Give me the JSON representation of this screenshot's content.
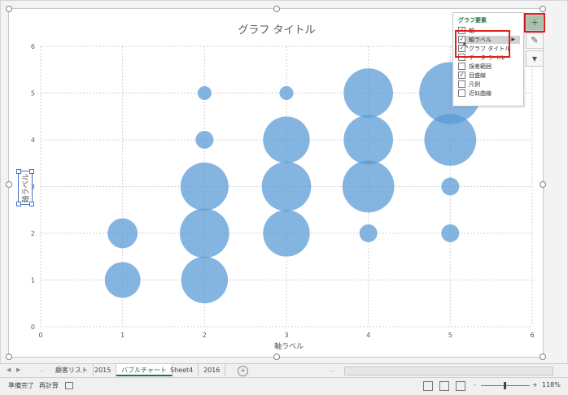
{
  "chart": {
    "title": "グラフ タイトル",
    "x_axis_title": "軸ラベル",
    "y_axis_title": "軸ラベル"
  },
  "chart_data": {
    "type": "scatter",
    "subtype": "bubble",
    "title": "グラフ タイトル",
    "xlabel": "軸ラベル",
    "ylabel": "軸ラベル",
    "xlim": [
      0,
      6
    ],
    "ylim": [
      0,
      6
    ],
    "x_ticks": [
      "0",
      "1",
      "2",
      "3",
      "4",
      "5",
      "6"
    ],
    "y_ticks": [
      "0",
      "1",
      "2",
      "3",
      "4",
      "5",
      "6"
    ],
    "grid": true,
    "legend": "none",
    "color": "#5b9bd5",
    "points": [
      {
        "x": 1,
        "y": 1,
        "size": 1.0
      },
      {
        "x": 1,
        "y": 2,
        "size": 0.7
      },
      {
        "x": 2,
        "y": 1,
        "size": 1.7
      },
      {
        "x": 2,
        "y": 2,
        "size": 1.9
      },
      {
        "x": 2,
        "y": 3,
        "size": 1.8
      },
      {
        "x": 2,
        "y": 4,
        "size": 0.25
      },
      {
        "x": 2,
        "y": 5,
        "size": 0.15
      },
      {
        "x": 3,
        "y": 2,
        "size": 1.7
      },
      {
        "x": 3,
        "y": 3,
        "size": 1.9
      },
      {
        "x": 3,
        "y": 4,
        "size": 1.7
      },
      {
        "x": 3,
        "y": 5,
        "size": 0.15
      },
      {
        "x": 4,
        "y": 2,
        "size": 0.25
      },
      {
        "x": 4,
        "y": 3,
        "size": 2.1
      },
      {
        "x": 4,
        "y": 4,
        "size": 1.9
      },
      {
        "x": 4,
        "y": 5,
        "size": 1.9
      },
      {
        "x": 5,
        "y": 2,
        "size": 0.25
      },
      {
        "x": 5,
        "y": 3,
        "size": 0.25
      },
      {
        "x": 5,
        "y": 4,
        "size": 2.1
      },
      {
        "x": 5,
        "y": 5,
        "size": 3.0
      }
    ]
  },
  "elements_panel": {
    "title": "グラフ要素",
    "items": [
      {
        "label": "軸",
        "checked": true
      },
      {
        "label": "軸ラベル",
        "checked": true,
        "highlighted": true
      },
      {
        "label": "グラフ タイトル",
        "checked": true
      },
      {
        "label": "データ ラベル",
        "checked": false
      },
      {
        "label": "誤差範囲",
        "checked": false
      },
      {
        "label": "目盛線",
        "checked": true
      },
      {
        "label": "凡例",
        "checked": false
      },
      {
        "label": "近似曲線",
        "checked": false
      }
    ]
  },
  "side_buttons": [
    {
      "icon": "plus-icon",
      "glyph": "+"
    },
    {
      "icon": "brush-icon",
      "glyph": "✎"
    },
    {
      "icon": "filter-icon",
      "glyph": "▼"
    }
  ],
  "sheet_tabs": {
    "tabs": [
      "顧客リスト",
      "2015",
      "バブルチャート",
      "Sheet4",
      "2016"
    ],
    "active": "バブルチャート",
    "add_glyph": "+",
    "more_glyph": "..."
  },
  "status_bar": {
    "ready": "準備完了",
    "recalc": "再計算",
    "zoom": "118%",
    "zoom_minus": "-",
    "zoom_plus": "+"
  }
}
